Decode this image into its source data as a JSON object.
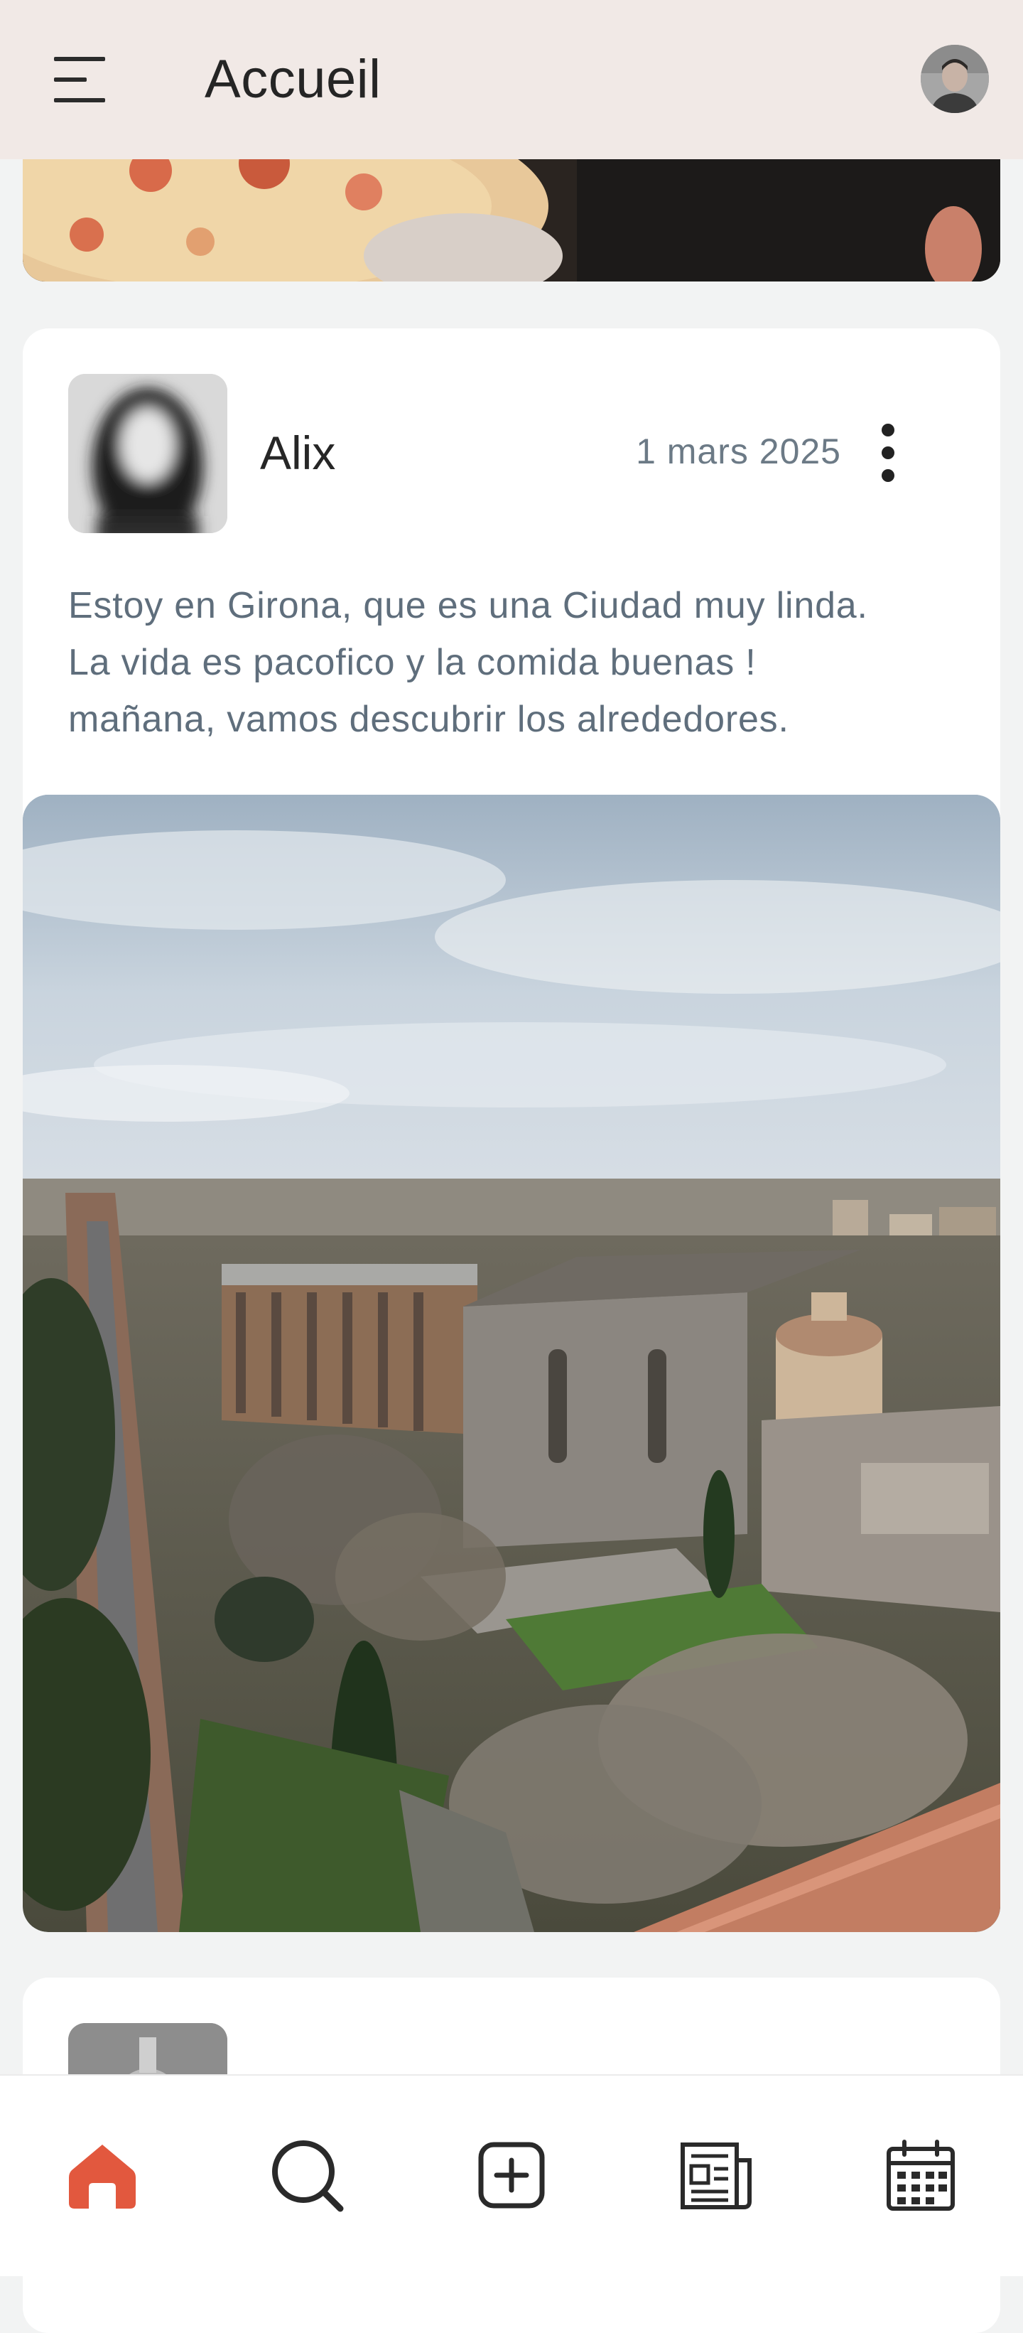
{
  "header": {
    "title": "Accueil",
    "menu_icon": "hamburger-menu-icon",
    "avatar_icon": "user-avatar"
  },
  "post": {
    "author": "Alix",
    "date": "1 mars 2025",
    "text_lines": [
      "Estoy en Girona, que es una Ciudad muy linda.",
      "La vida es pacofico y la comida buenas !",
      "mañana, vamos descubrir los alrededores."
    ],
    "image_description_icon": "post-photo",
    "more_icon": "more-vertical-icon"
  },
  "bottom_nav": {
    "items": [
      {
        "icon": "home-icon",
        "active": true
      },
      {
        "icon": "search-icon",
        "active": false
      },
      {
        "icon": "add-post-icon",
        "active": false
      },
      {
        "icon": "news-icon",
        "active": false
      },
      {
        "icon": "calendar-icon",
        "active": false
      }
    ]
  },
  "colors": {
    "header_bg": "#f1e9e6",
    "page_bg": "#f2f3f3",
    "accent": "#e2583e",
    "muted_text": "#5f6e7c",
    "date_text": "#6c7a86"
  }
}
